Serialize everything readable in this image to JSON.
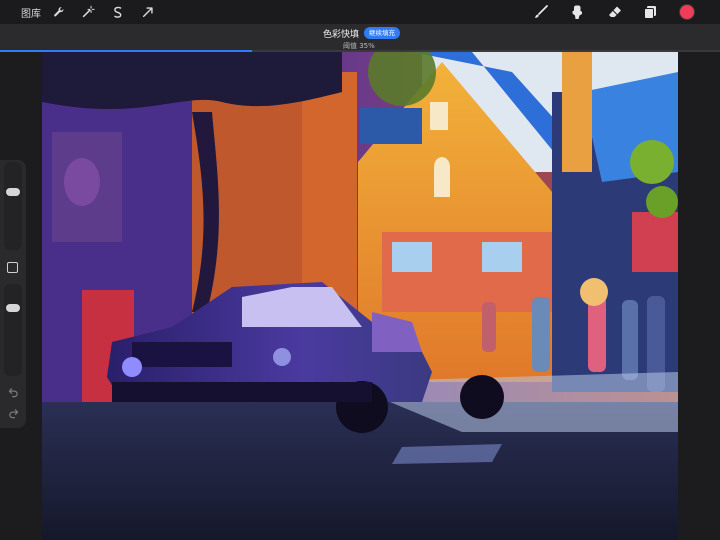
{
  "toolbar": {
    "gallery_label": "图库",
    "left_icons": [
      "wrench-icon",
      "magic-wand-icon",
      "selection-icon",
      "transform-arrow-icon"
    ],
    "right_icons": [
      "brush-icon",
      "smudge-icon",
      "eraser-icon",
      "layers-icon"
    ],
    "current_color": "#ef3c58"
  },
  "fill_banner": {
    "title": "色彩快填",
    "continue_label": "继续填充",
    "threshold_label": "阈值 35%",
    "threshold_percent": 35,
    "accent_color": "#2f7cf6"
  },
  "sidebar": {
    "brush_size_level": 0.15,
    "opacity_level": 0.05
  }
}
